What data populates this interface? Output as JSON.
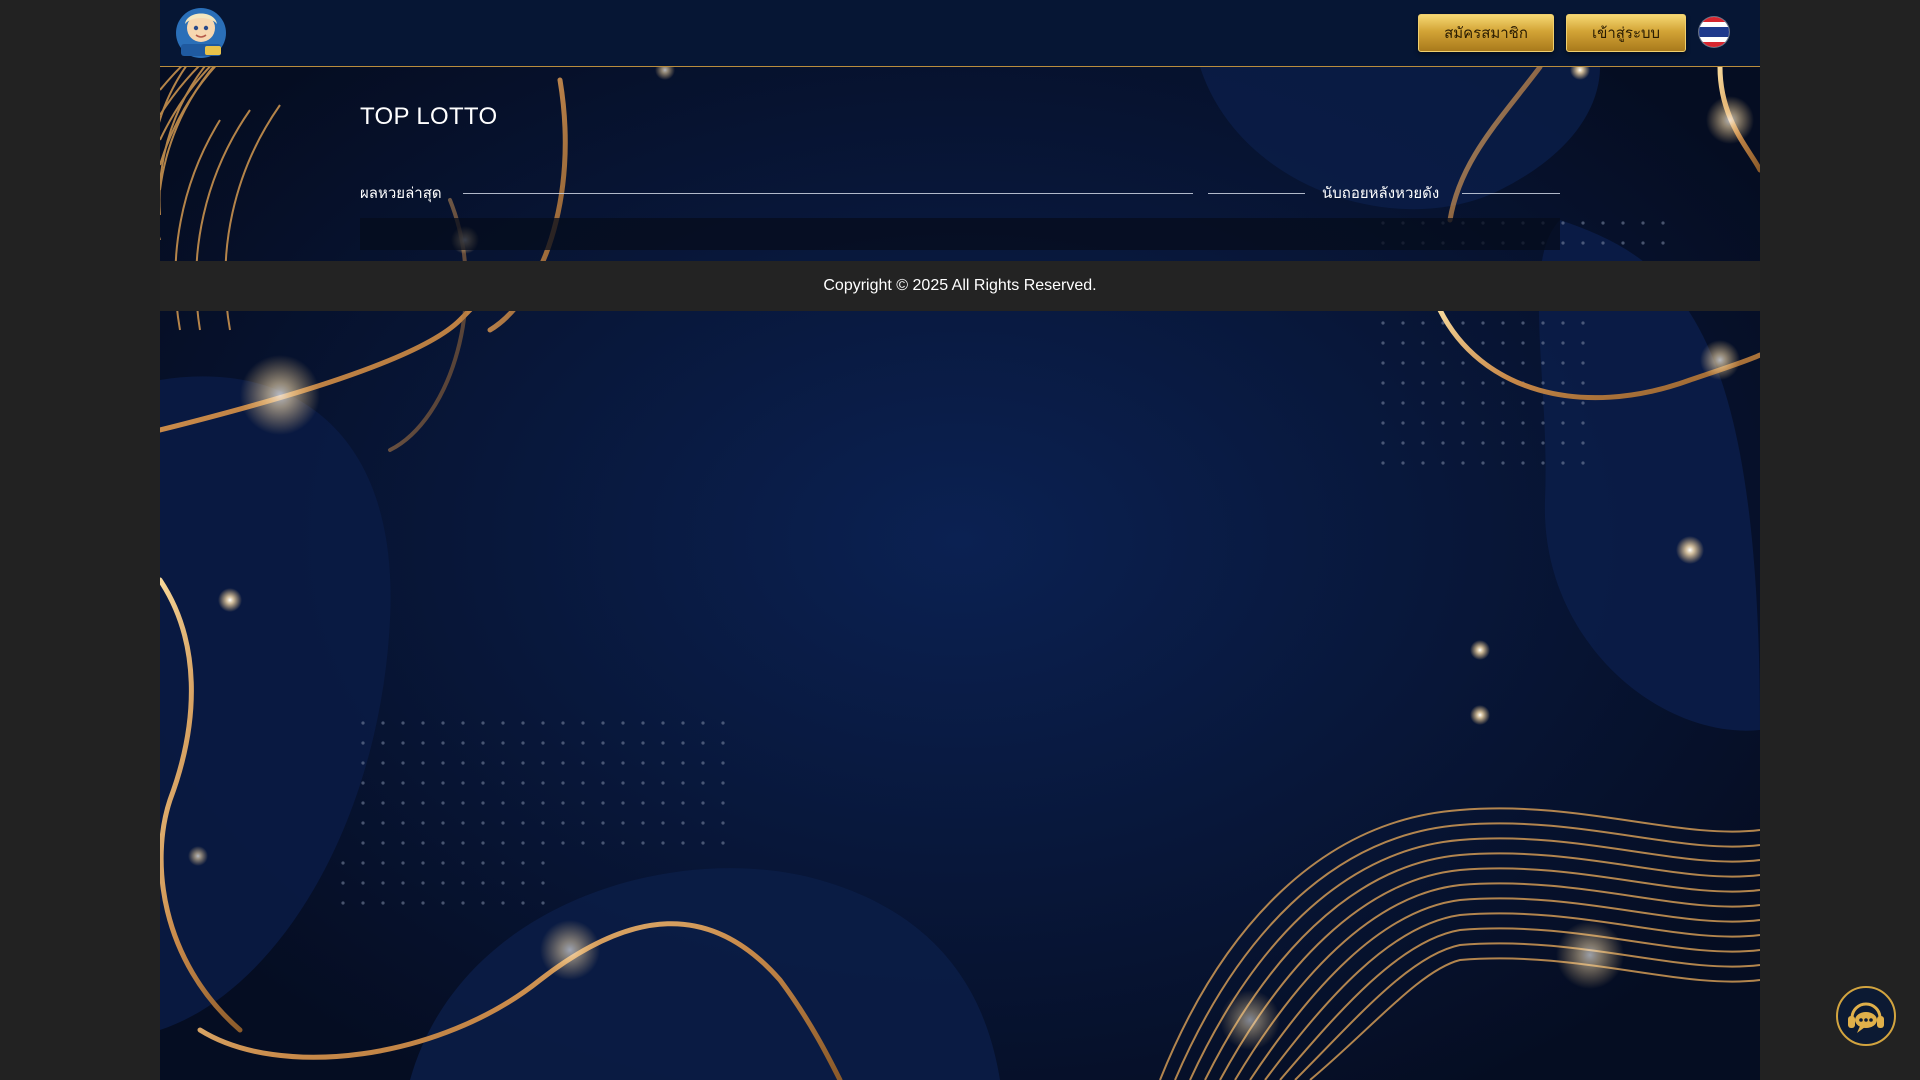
{
  "header": {
    "logo_icon": "mascot-logo-icon",
    "register_label": "สมัครสมาชิก",
    "login_label": "เข้าสู่ระบบ",
    "language_icon": "thai-flag-icon"
  },
  "main": {
    "title": "TOP LOTTO",
    "latest_results_label": "ผลหวยล่าสุด",
    "countdown_label": "นับถอยหลังหวยดัง"
  },
  "footer": {
    "copyright": "Copyright © 2025 All Rights Reserved."
  },
  "chat": {
    "icon": "chat-support-icon"
  },
  "colors": {
    "page_background": "#07142e",
    "outer_background": "#222222",
    "gold_accent": "#d3a436",
    "footer_background": "#232323"
  }
}
